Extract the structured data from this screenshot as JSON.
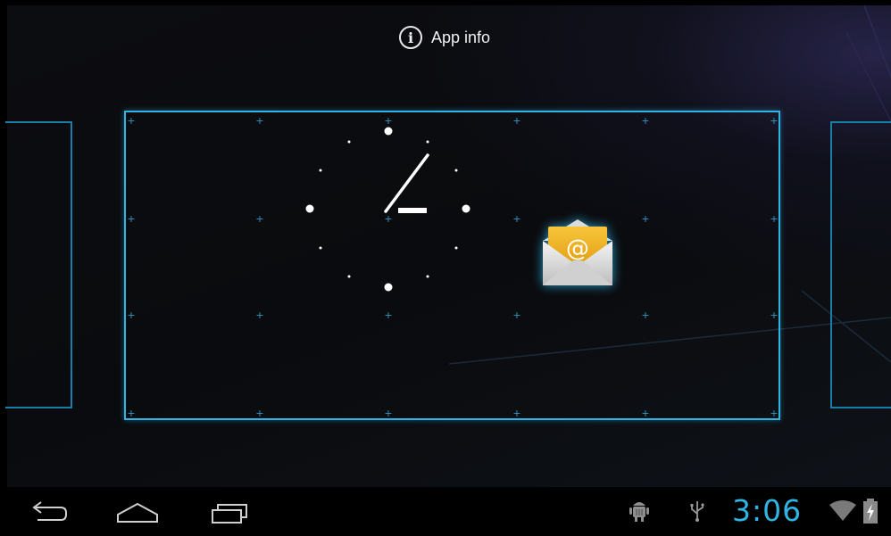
{
  "header": {
    "action_label": "App info",
    "action_icon": "info-icon"
  },
  "workspace": {
    "widgets": [
      {
        "type": "analog-clock",
        "hour_hand_hour": 3,
        "minute_hand_minute": 6
      },
      {
        "type": "app-shortcut",
        "icon": "email-icon",
        "name": ""
      }
    ]
  },
  "navbar": {
    "buttons": [
      "back-icon",
      "home-icon",
      "recent-apps-icon"
    ]
  },
  "status_bar": {
    "time": "3:06",
    "icons": [
      "android-debug-icon",
      "usb-icon",
      "wifi-icon",
      "battery-charging-icon"
    ]
  },
  "colors": {
    "accent": "#2fb4e4",
    "background": "#000000"
  }
}
